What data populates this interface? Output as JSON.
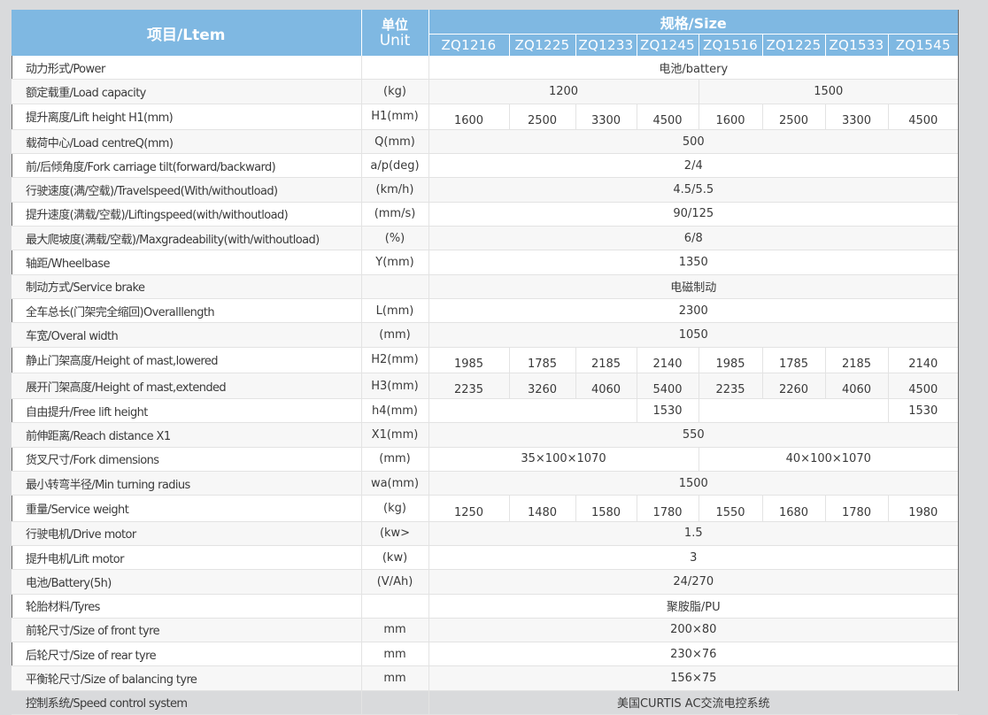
{
  "header": {
    "item": "项目/Ltem",
    "unit_cn": "单位",
    "unit_en": "Unit",
    "size": "规格/Size",
    "models": [
      "ZQ1216",
      "ZQ1225",
      "ZQ1233",
      "ZQ1245",
      "ZQ1516",
      "ZQ1225",
      "ZQ1533",
      "ZQ1545"
    ]
  },
  "rows": {
    "power": {
      "label": "动力形式/Power",
      "unit": "",
      "v": "电池/battery"
    },
    "load": {
      "label": "额定载重/Load capacity",
      "unit": "(kg)",
      "a": "1200",
      "b": "1500"
    },
    "lift": {
      "label": "提升离度/Lift height H1(mm)",
      "unit": "H1(mm)",
      "v": [
        "1600",
        "2500",
        "3300",
        "4500",
        "1600",
        "2500",
        "3300",
        "4500"
      ]
    },
    "center": {
      "label": "载荷中心/Load centreQ(mm)",
      "unit": "Q(mm)",
      "v": "500"
    },
    "tilt": {
      "label": "前/后倾角度/Fork carriage tilt(forward/backward)",
      "unit": "a/p(deg)",
      "v": "2/4"
    },
    "travel": {
      "label": "行驶速度(满/空载)/Travelspeed(With/withoutload)",
      "unit": "(km/h)",
      "v": "4.5/5.5"
    },
    "liftspeed": {
      "label": "提升速度(满载/空载)/Liftingspeed(with/withoutload)",
      "unit": "(mm/s)",
      "v": "90/125"
    },
    "grade": {
      "label": "最大爬坡度(满载/空载)/Maxgradeability(with/withoutload)",
      "unit": "(%)",
      "v": "6/8"
    },
    "wheelbase": {
      "label": "轴距/Wheelbase",
      "unit": "Y(mm)",
      "v": "1350"
    },
    "brake": {
      "label": "制动方式/Service brake",
      "unit": "",
      "v": "电磁制动"
    },
    "length": {
      "label": "全车总长(门架完全缩回)Overalllength",
      "unit": "L(mm)",
      "v": "2300"
    },
    "width": {
      "label": "车宽/Overal width",
      "unit": "(mm)",
      "v": "1050"
    },
    "mastlow": {
      "label": "静止门架高度/Height of mast,lowered",
      "unit": "H2(mm)",
      "v": [
        "1985",
        "1785",
        "2185",
        "2140",
        "1985",
        "1785",
        "2185",
        "2140"
      ]
    },
    "mastext": {
      "label": "展开门架高度/Height of mast,extended",
      "unit": "H3(mm)",
      "v": [
        "2235",
        "3260",
        "4060",
        "5400",
        "2235",
        "2260",
        "4060",
        "4500"
      ]
    },
    "freelift": {
      "label": "自由提升/Free lift height",
      "unit": "h4(mm)",
      "a": "1530",
      "b": "1530"
    },
    "reach": {
      "label": "前伸距离/Reach distance X1",
      "unit": "X1(mm)",
      "v": "550"
    },
    "fork": {
      "label": "货叉尺寸/Fork dimensions",
      "unit": "(mm)",
      "a": "35×100×1070",
      "b": "40×100×1070"
    },
    "turn": {
      "label": "最小转弯半径/Min turning radius",
      "unit": "wa(mm)",
      "v": "1500"
    },
    "weight": {
      "label": "重量/Service weight",
      "unit": "(kg)",
      "v": [
        "1250",
        "1480",
        "1580",
        "1780",
        "1550",
        "1680",
        "1780",
        "1980"
      ]
    },
    "drive": {
      "label": "行驶电机/Drive motor",
      "unit": "(kw>",
      "v": "1.5"
    },
    "liftmotor": {
      "label": "提升电机/Lift motor",
      "unit": "(kw)",
      "v": "3"
    },
    "battery": {
      "label": "电池/Battery(5h)",
      "unit": "(V/Ah)",
      "v": "24/270"
    },
    "tyres": {
      "label": "轮胎材料/Tyres",
      "unit": "",
      "v": "聚胺脂/PU"
    },
    "front": {
      "label": "前轮尺寸/Size of front tyre",
      "unit": "mm",
      "v": "200×80"
    },
    "rear": {
      "label": "后轮尺寸/Size of rear tyre",
      "unit": "mm",
      "v": "230×76"
    },
    "balance": {
      "label": "平衡轮尺寸/Size of balancing tyre",
      "unit": "mm",
      "v": "156×75"
    },
    "control": {
      "label": "控制系统/Speed control system",
      "unit": "",
      "v": "美国CURTIS AC交流电控系统"
    }
  }
}
